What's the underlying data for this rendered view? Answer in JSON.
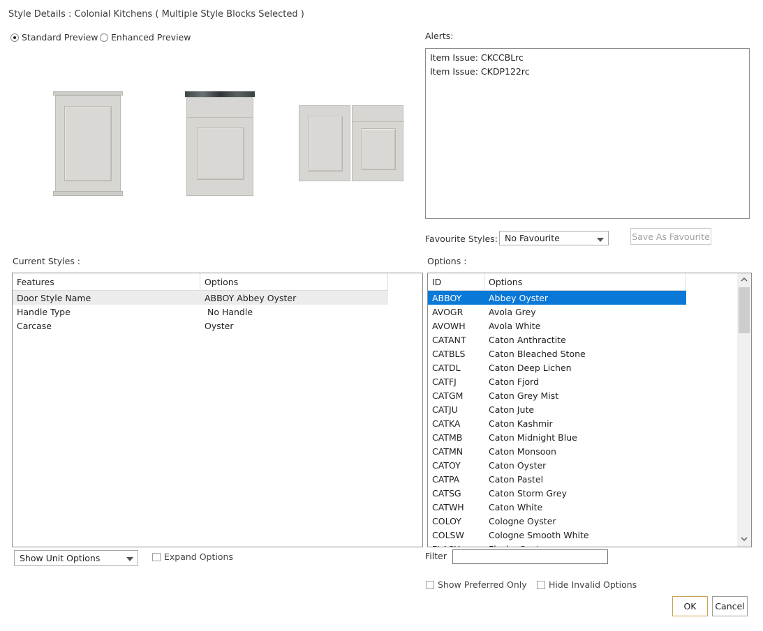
{
  "window": {
    "title": "Style Details : Colonial Kitchens ( Multiple Style Blocks Selected )"
  },
  "preview": {
    "standard_label": "Standard Preview",
    "enhanced_label": "Enhanced Preview",
    "selected": "standard"
  },
  "alerts": {
    "label": "Alerts:",
    "items": [
      "Item Issue: CKCCBLrc",
      "Item Issue: CKDP122rc"
    ]
  },
  "favourites": {
    "label": "Favourite Styles:",
    "selected": "No Favourite",
    "save_label": "Save As Favourite"
  },
  "current_styles": {
    "label": "Current Styles :",
    "columns": [
      "Features",
      "Options"
    ],
    "rows": [
      {
        "feature": "Door Style Name",
        "option": "ABBOY Abbey Oyster"
      },
      {
        "feature": "Handle Type",
        "option": " No Handle"
      },
      {
        "feature": "Carcase",
        "option": "Oyster"
      }
    ]
  },
  "options": {
    "label": "Options :",
    "columns": [
      "ID",
      "Options"
    ],
    "rows": [
      {
        "id": "ABBOY",
        "name": "Abbey Oyster"
      },
      {
        "id": "AVOGR",
        "name": "Avola Grey"
      },
      {
        "id": "AVOWH",
        "name": "Avola White"
      },
      {
        "id": "CATANT",
        "name": "Caton Anthractite"
      },
      {
        "id": "CATBLS",
        "name": "Caton Bleached Stone"
      },
      {
        "id": "CATDL",
        "name": "Caton Deep Lichen"
      },
      {
        "id": "CATFJ",
        "name": "Caton Fjord"
      },
      {
        "id": "CATGM",
        "name": "Caton Grey Mist"
      },
      {
        "id": "CATJU",
        "name": "Caton Jute"
      },
      {
        "id": "CATKA",
        "name": "Caton Kashmir"
      },
      {
        "id": "CATMB",
        "name": "Caton Midnight Blue"
      },
      {
        "id": "CATMN",
        "name": "Caton Monsoon"
      },
      {
        "id": "CATOY",
        "name": "Caton Oyster"
      },
      {
        "id": "CATPA",
        "name": "Caton Pastel"
      },
      {
        "id": "CATSG",
        "name": "Caton Storm Grey"
      },
      {
        "id": "CATWH",
        "name": "Caton White"
      },
      {
        "id": "COLOY",
        "name": "Cologne Oyster"
      },
      {
        "id": "COLSW",
        "name": "Cologne Smooth White"
      },
      {
        "id": "FLAOY",
        "name": "Flasby Oyster"
      }
    ],
    "selected_index": 0
  },
  "bottom_left": {
    "unit_options_selected": "Show Unit Options",
    "expand_label": "Expand Options"
  },
  "bottom_right": {
    "filter_label": "Filter",
    "filter_value": "",
    "show_preferred_label": "Show Preferred Only",
    "hide_invalid_label": "Hide Invalid Options"
  },
  "actions": {
    "ok_label": "OK",
    "cancel_label": "Cancel"
  },
  "colors": {
    "selection_blue": "#0a78d7",
    "ok_border": "#c9a44c",
    "door_finish": "#d8d6d2"
  }
}
